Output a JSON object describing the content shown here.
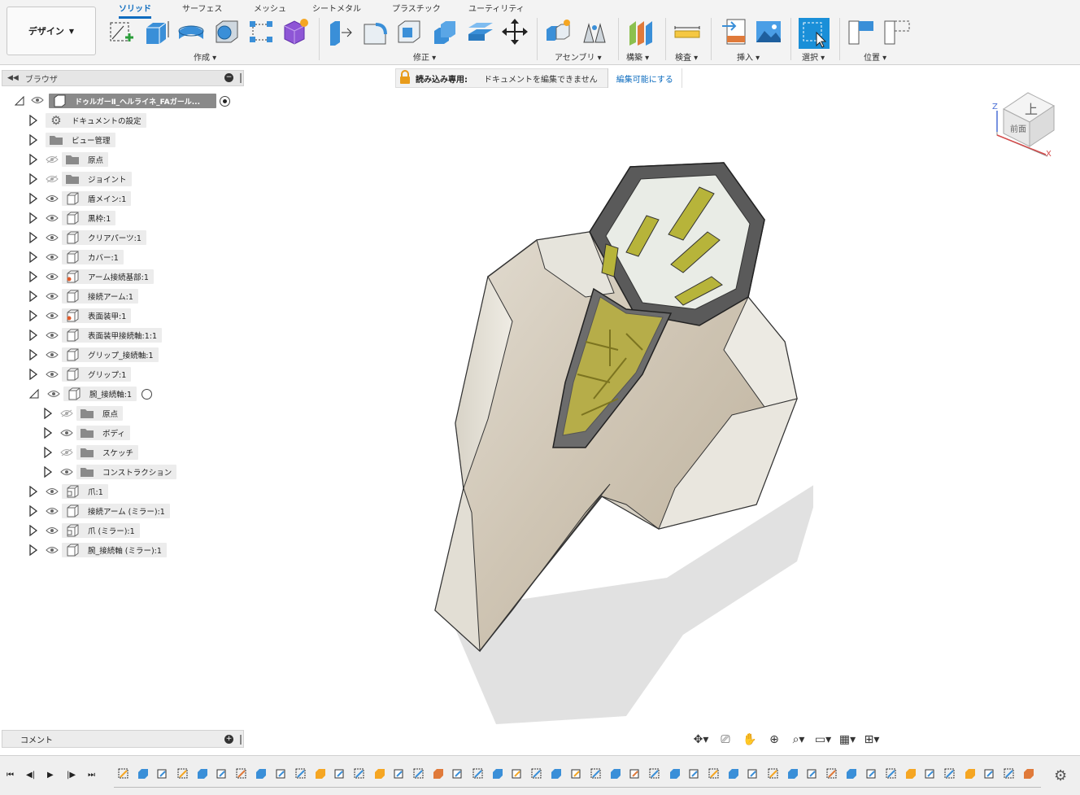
{
  "toolbar": {
    "workspace_label": "デザイン",
    "tabs": [
      "ソリッド",
      "サーフェス",
      "メッシュ",
      "シートメタル",
      "プラスチック",
      "ユーティリティ"
    ],
    "groups": [
      "作成",
      "修正",
      "アセンブリ",
      "構築",
      "検査",
      "挿入",
      "選択",
      "位置"
    ]
  },
  "browser": {
    "title": "ブラウザ",
    "root": "ドゥルガーⅡ_ヘルライネ_FAガール...",
    "items": [
      {
        "label": "ドキュメントの設定",
        "icon": "gear-icon",
        "visible": null
      },
      {
        "label": "ビュー管理",
        "icon": "folder-icon",
        "visible": null
      },
      {
        "label": "原点",
        "icon": "folder-icon",
        "visible": false
      },
      {
        "label": "ジョイント",
        "icon": "folder-icon",
        "visible": false
      },
      {
        "label": "盾メイン:1",
        "icon": "component-icon",
        "visible": true
      },
      {
        "label": "黒枠:1",
        "icon": "component-icon",
        "visible": true
      },
      {
        "label": "クリアパーツ:1",
        "icon": "component-icon",
        "visible": true
      },
      {
        "label": "カバー:1",
        "icon": "component-icon",
        "visible": true
      },
      {
        "label": "アーム接続基部:1",
        "icon": "component-linked-icon",
        "visible": true
      },
      {
        "label": "接続アーム:1",
        "icon": "component-icon",
        "visible": true
      },
      {
        "label": "表面装甲:1",
        "icon": "component-linked-icon",
        "visible": true
      },
      {
        "label": "表面装甲接続軸:1:1",
        "icon": "component-icon",
        "visible": true
      },
      {
        "label": "グリップ_接続軸:1",
        "icon": "component-icon",
        "visible": true
      },
      {
        "label": "グリップ:1",
        "icon": "component-icon",
        "visible": true
      },
      {
        "label": "腕_接続軸:1",
        "icon": "component-icon",
        "visible": true,
        "expanded": true
      },
      {
        "label": "原点",
        "icon": "folder-icon",
        "visible": false,
        "child": true
      },
      {
        "label": "ボディ",
        "icon": "folder-icon",
        "visible": true,
        "child": true
      },
      {
        "label": "スケッチ",
        "icon": "folder-icon",
        "visible": false,
        "child": true
      },
      {
        "label": "コンストラクション",
        "icon": "folder-icon",
        "visible": true,
        "child": true
      },
      {
        "label": "爪:1",
        "icon": "component-multi-icon",
        "visible": true
      },
      {
        "label": "接続アーム (ミラー):1",
        "icon": "component-icon",
        "visible": true
      },
      {
        "label": "爪 (ミラー):1",
        "icon": "component-multi-icon",
        "visible": true
      },
      {
        "label": "腕_接続軸 (ミラー):1",
        "icon": "component-icon",
        "visible": true
      }
    ]
  },
  "readonly_bar": {
    "title": "読み込み専用:",
    "message": "ドキュメントを編集できません",
    "link": "編集可能にする"
  },
  "viewcube": {
    "top_face": "上",
    "front_face": "前面",
    "axis_z": "Z",
    "axis_x": "X"
  },
  "comments": {
    "label": "コメント"
  },
  "colors": {
    "accent": "#0d6cbf",
    "select_blue": "#1a8fd8"
  }
}
